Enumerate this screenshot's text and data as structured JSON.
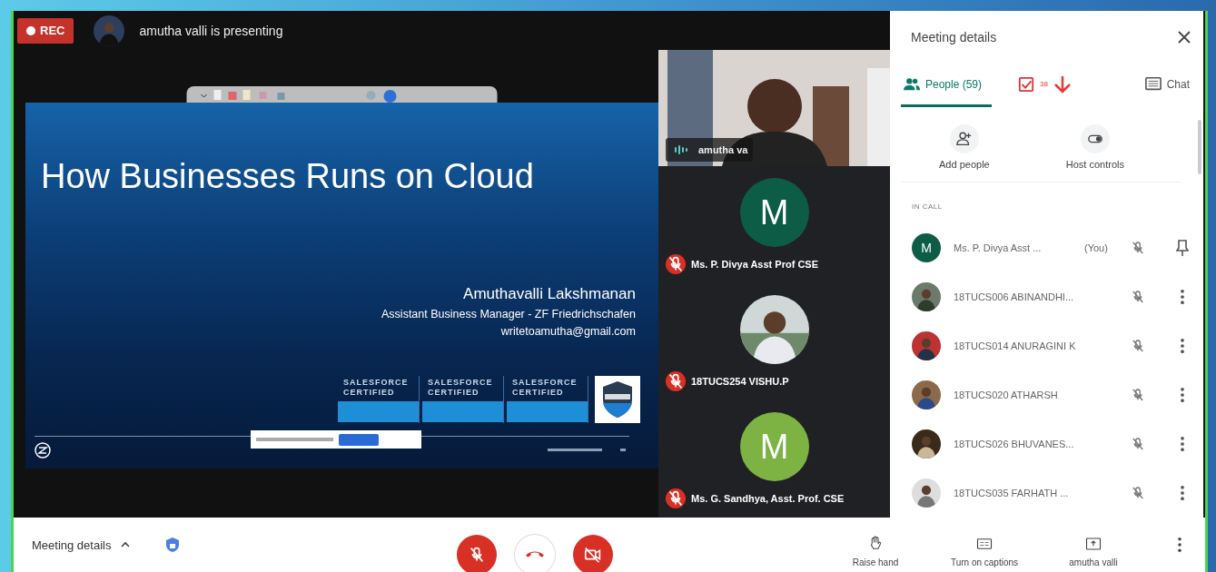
{
  "recording": {
    "label": "REC",
    "on": true
  },
  "presenter_banner": {
    "text": "amutha valli is presenting"
  },
  "slide": {
    "title": "How Businesses Runs on Cloud",
    "author": "Amuthavalli Lakshmanan",
    "role": "Assistant Business Manager - ZF Friedrichschafen",
    "email": "writetoamutha@gmail.com",
    "badges": [
      {
        "line1": "SALESFORCE",
        "line2": "CERTIFIED"
      },
      {
        "line1": "SALESFORCE",
        "line2": "CERTIFIED"
      },
      {
        "line1": "SALESFORCE",
        "line2": "CERTIFIED"
      }
    ]
  },
  "tiles": [
    {
      "kind": "video",
      "name": "amutha va",
      "speaking": true,
      "muted": false
    },
    {
      "kind": "initial",
      "initial": "M",
      "color": "#0d5c46",
      "name": "Ms. P. Divya Asst Prof CSE",
      "muted": true
    },
    {
      "name": "18TUCS254 VISHU.P",
      "muted": true
    },
    {
      "kind": "initial",
      "initial": "M",
      "color": "#7cb342",
      "name": "Ms. G. Sandhya, Asst. Prof. CSE",
      "muted": true
    }
  ],
  "panel": {
    "title": "Meeting details",
    "tabs": [
      {
        "kind": "people",
        "label": "People (59)",
        "selected": true
      },
      {
        "kind": "tasks",
        "label": "38",
        "selected": false
      },
      {
        "kind": "chat",
        "label": "Chat",
        "selected": false
      }
    ],
    "actions": [
      {
        "kind": "add",
        "label": "Add people"
      },
      {
        "kind": "host",
        "label": "Host controls"
      }
    ],
    "section": "IN CALL",
    "people": [
      {
        "kind": "self",
        "initial": "M",
        "color": "#0d5c46",
        "name": "Ms. P. Divya Asst ...",
        "note": "(You)",
        "muted": true
      },
      {
        "kind": "guest",
        "name": "18TUCS006 ABINANDHI...",
        "muted": true
      },
      {
        "kind": "guest",
        "name": "18TUCS014 ANURAGINI K",
        "muted": true
      },
      {
        "kind": "guest",
        "name": "18TUCS020 ATHARSH",
        "muted": true
      },
      {
        "kind": "guest",
        "name": "18TUCS026 BHUVANES...",
        "muted": true
      },
      {
        "kind": "guest",
        "name": "18TUCS035 FARHATH ...",
        "muted": true
      }
    ]
  },
  "bottom": {
    "details": "Meeting details",
    "controls": [
      {
        "kind": "mic",
        "off": true
      },
      {
        "kind": "hangup"
      },
      {
        "kind": "camera",
        "off": true
      }
    ],
    "actions": [
      {
        "kind": "hand",
        "label": "Raise hand"
      },
      {
        "kind": "captions",
        "label": "Turn on captions"
      },
      {
        "kind": "present",
        "label": "amutha valli"
      }
    ]
  }
}
